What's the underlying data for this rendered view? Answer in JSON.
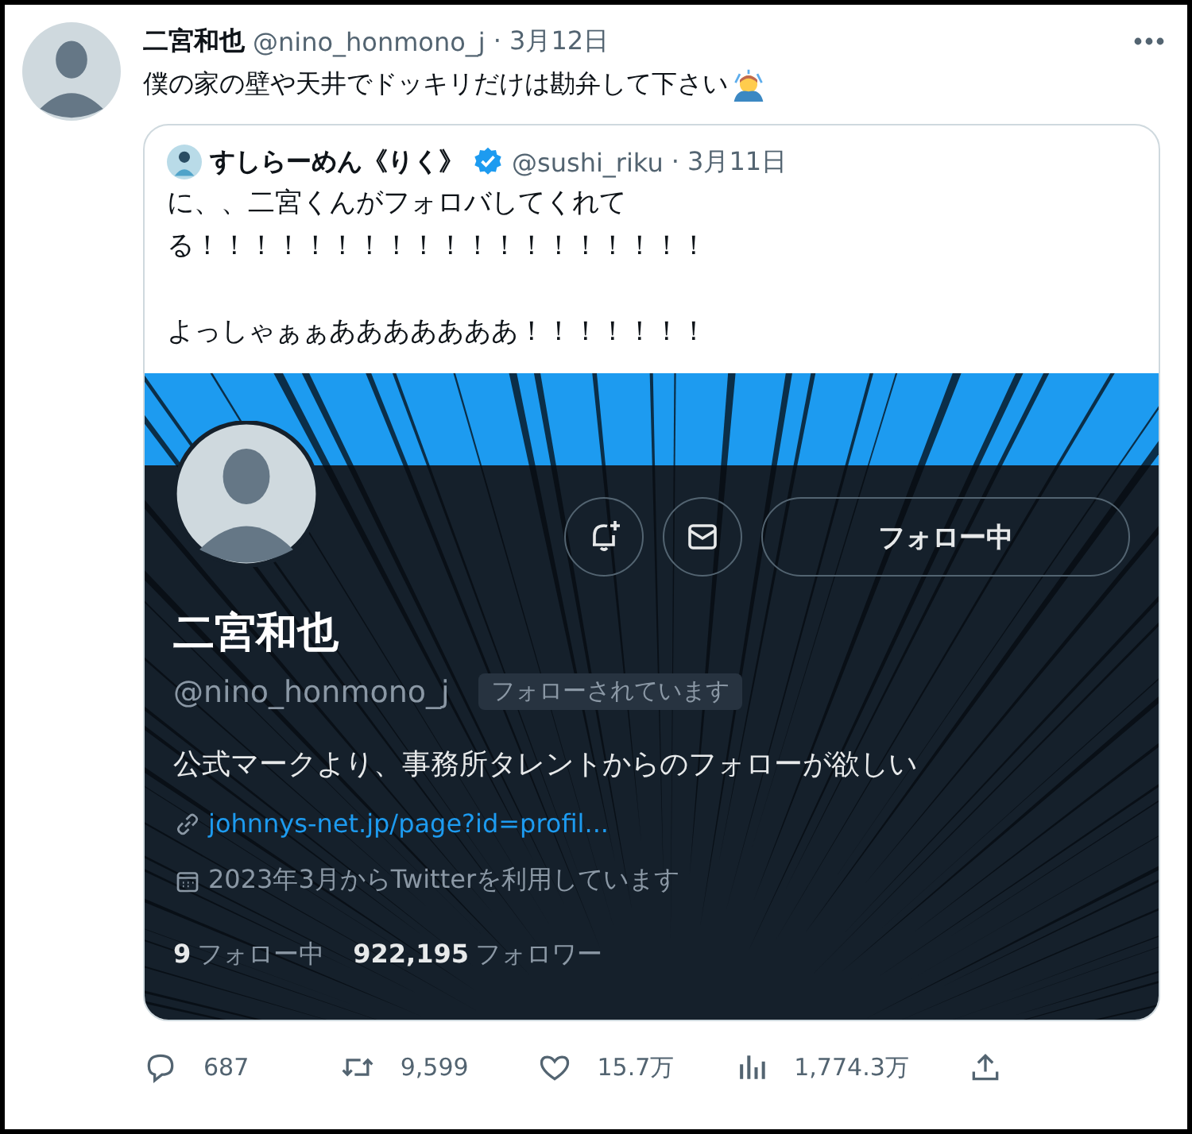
{
  "tweet": {
    "author": {
      "name": "二宮和也",
      "handle": "@nino_honmono_j",
      "date": "· 3月12日"
    },
    "text": "僕の家の壁や天井でドッキリだけは勘弁して下さい",
    "quote": {
      "author": {
        "name": "すしらーめん《りく》",
        "verified": true,
        "handle": "@sushi_riku",
        "date": "· 3月11日"
      },
      "paragraphs": [
        "に、、二宮くんがフォロバしてくれてる！！！！！！！！！！！！！！！！！！！",
        "よっしゃぁぁあああああああ！！！！！！！"
      ],
      "profile": {
        "name": "二宮和也",
        "handle": "@nino_honmono_j",
        "follows_you": "フォローされています",
        "follow_button": "フォロー中",
        "bio": "公式マークより、事務所タレントからのフォローが欲しい",
        "link": "johnnys-net.jp/page?id=profil...",
        "joined": "2023年3月からTwitterを利用しています",
        "stats": [
          {
            "count": "9",
            "label": "フォロー中"
          },
          {
            "count": "922,195",
            "label": "フォロワー"
          }
        ]
      }
    },
    "actions": [
      {
        "kind": "reply",
        "count": "687"
      },
      {
        "kind": "retweet",
        "count": "9,599"
      },
      {
        "kind": "like",
        "count": "15.7万"
      },
      {
        "kind": "views",
        "count": "1,774.3万"
      },
      {
        "kind": "share"
      }
    ]
  }
}
